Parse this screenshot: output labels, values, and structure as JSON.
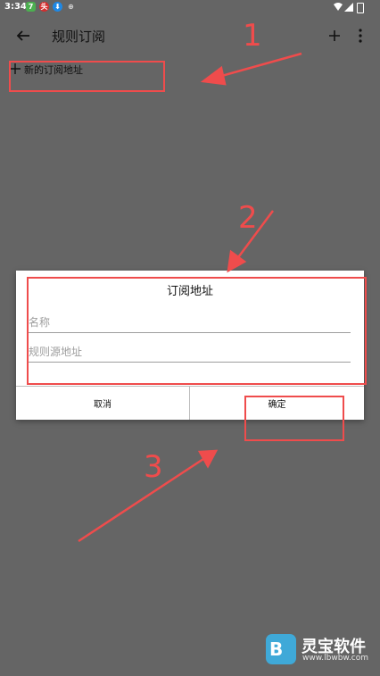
{
  "status_bar": {
    "time": "3:34",
    "notif_icons": [
      "7",
      "头",
      "⬇",
      "⊕"
    ]
  },
  "toolbar": {
    "title": "规则订阅"
  },
  "list": {
    "add_item_label": "新的订阅地址"
  },
  "dialog": {
    "title": "订阅地址",
    "name_placeholder": "名称",
    "name_value": "",
    "url_placeholder": "规则源地址",
    "url_value": "",
    "cancel_label": "取消",
    "ok_label": "确定"
  },
  "annotations": {
    "step_1": "1",
    "step_2": "2",
    "step_3": "3",
    "color": "#ef4c4c"
  },
  "watermark": {
    "logo_letter": "B",
    "name": "灵宝软件",
    "url": "www.lbwbw.com"
  },
  "colors": {
    "background_dim": "#656565",
    "dialog_bg": "#ffffff",
    "watermark_logo": "#3fa9d8"
  }
}
